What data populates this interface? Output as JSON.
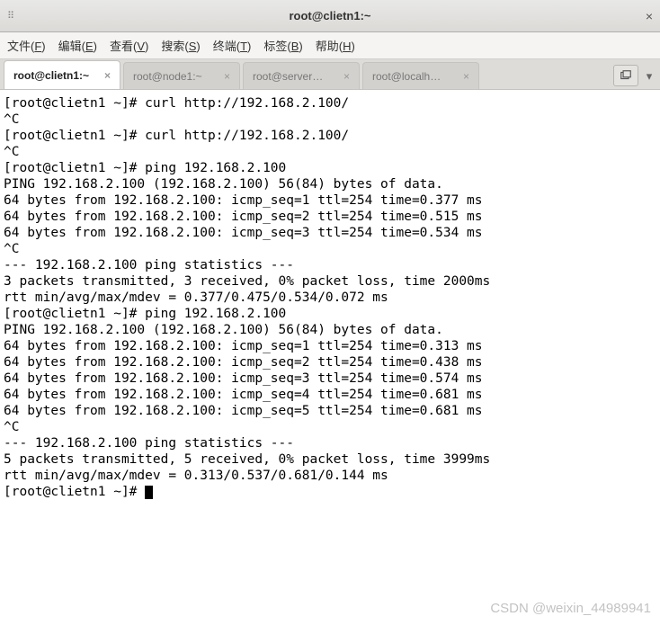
{
  "window": {
    "title": "root@clietn1:~"
  },
  "menu": {
    "file": "文件(F)",
    "edit": "编辑(E)",
    "view": "查看(V)",
    "search": "搜索(S)",
    "terminal": "终端(T)",
    "tags": "标签(B)",
    "help": "帮助(H)"
  },
  "tabs": [
    {
      "label": "root@clietn1:~",
      "active": true
    },
    {
      "label": "root@node1:~",
      "active": false
    },
    {
      "label": "root@server…",
      "active": false
    },
    {
      "label": "root@localh…",
      "active": false
    }
  ],
  "terminal_lines": [
    "[root@clietn1 ~]# curl http://192.168.2.100/",
    "^C",
    "[root@clietn1 ~]# curl http://192.168.2.100/",
    "^C",
    "[root@clietn1 ~]# ping 192.168.2.100",
    "PING 192.168.2.100 (192.168.2.100) 56(84) bytes of data.",
    "64 bytes from 192.168.2.100: icmp_seq=1 ttl=254 time=0.377 ms",
    "64 bytes from 192.168.2.100: icmp_seq=2 ttl=254 time=0.515 ms",
    "64 bytes from 192.168.2.100: icmp_seq=3 ttl=254 time=0.534 ms",
    "^C",
    "--- 192.168.2.100 ping statistics ---",
    "3 packets transmitted, 3 received, 0% packet loss, time 2000ms",
    "rtt min/avg/max/mdev = 0.377/0.475/0.534/0.072 ms",
    "[root@clietn1 ~]# ping 192.168.2.100",
    "PING 192.168.2.100 (192.168.2.100) 56(84) bytes of data.",
    "64 bytes from 192.168.2.100: icmp_seq=1 ttl=254 time=0.313 ms",
    "64 bytes from 192.168.2.100: icmp_seq=2 ttl=254 time=0.438 ms",
    "64 bytes from 192.168.2.100: icmp_seq=3 ttl=254 time=0.574 ms",
    "64 bytes from 192.168.2.100: icmp_seq=4 ttl=254 time=0.681 ms",
    "64 bytes from 192.168.2.100: icmp_seq=5 ttl=254 time=0.681 ms",
    "^C",
    "--- 192.168.2.100 ping statistics ---",
    "5 packets transmitted, 5 received, 0% packet loss, time 3999ms",
    "rtt min/avg/max/mdev = 0.313/0.537/0.681/0.144 ms"
  ],
  "prompt": "[root@clietn1 ~]# ",
  "watermark": "CSDN @weixin_44989941"
}
